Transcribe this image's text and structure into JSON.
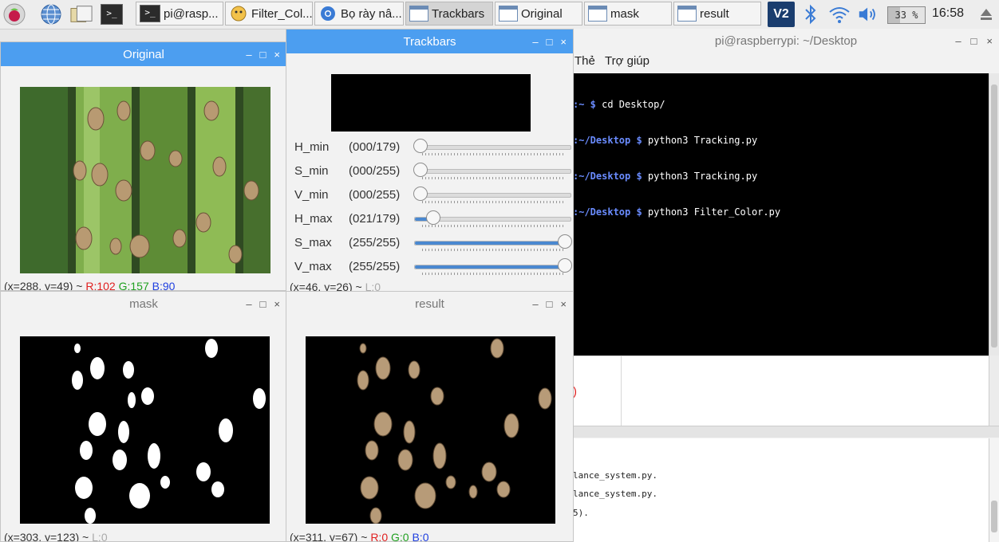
{
  "taskbar": {
    "tasks": [
      {
        "label": "pi@rasp..."
      },
      {
        "label": "Filter_Col..."
      },
      {
        "label": "Bọ rày nâ..."
      },
      {
        "label": "Trackbars"
      },
      {
        "label": "Original"
      },
      {
        "label": "mask"
      },
      {
        "label": "result"
      }
    ],
    "battery": "33 %",
    "clock": "16:58",
    "vnc_label": "V2"
  },
  "windows": {
    "original": {
      "title": "Original",
      "status_coords": "(x=288, y=49) ~",
      "status_r": "R:102",
      "status_g": "G:157",
      "status_b": "B:90"
    },
    "trackbars": {
      "title": "Trackbars",
      "rows": [
        {
          "name": "H_min",
          "value": "(000/179)",
          "level": 0.0
        },
        {
          "name": "S_min",
          "value": "(000/255)",
          "level": 0.0
        },
        {
          "name": "V_min",
          "value": "(000/255)",
          "level": 0.0
        },
        {
          "name": "H_max",
          "value": "(021/179)",
          "level": 0.117
        },
        {
          "name": "S_max",
          "value": "(255/255)",
          "level": 1.0
        },
        {
          "name": "V_max",
          "value": "(255/255)",
          "level": 1.0
        }
      ],
      "status_coords": "(x=46, y=26) ~",
      "status_l": "L:0"
    },
    "mask": {
      "title": "mask",
      "status_coords": "(x=303, y=123) ~",
      "status_l": "L:0"
    },
    "result": {
      "title": "result",
      "status_coords": "(x=311, y=67) ~",
      "status_r": "R:0",
      "status_g": "G:0",
      "status_b": "B:0"
    },
    "btn_min": "–",
    "btn_max": "□",
    "btn_close": "×"
  },
  "terminal": {
    "title": "pi@raspberrypi: ~/Desktop",
    "menu": [
      "Thẻ",
      "Trợ giúp"
    ],
    "lines": [
      {
        "prefix": ":~ $ ",
        "cmd": "cd Desktop/"
      },
      {
        "prefix": ":~/Desktop $ ",
        "cmd": "python3 Tracking.py"
      },
      {
        "prefix": ":~/Desktop $ ",
        "cmd": "python3 Tracking.py"
      },
      {
        "prefix": ":~/Desktop $ ",
        "cmd": "python3 Filter_Color.py"
      }
    ],
    "lower_lines": [
      "lance_system.py.",
      "lance_system.py.",
      "5)."
    ],
    "red_paren": ")"
  },
  "colors": {
    "focus_blue": "#4c9ef0",
    "prompt_blue": "#6a8cff"
  }
}
